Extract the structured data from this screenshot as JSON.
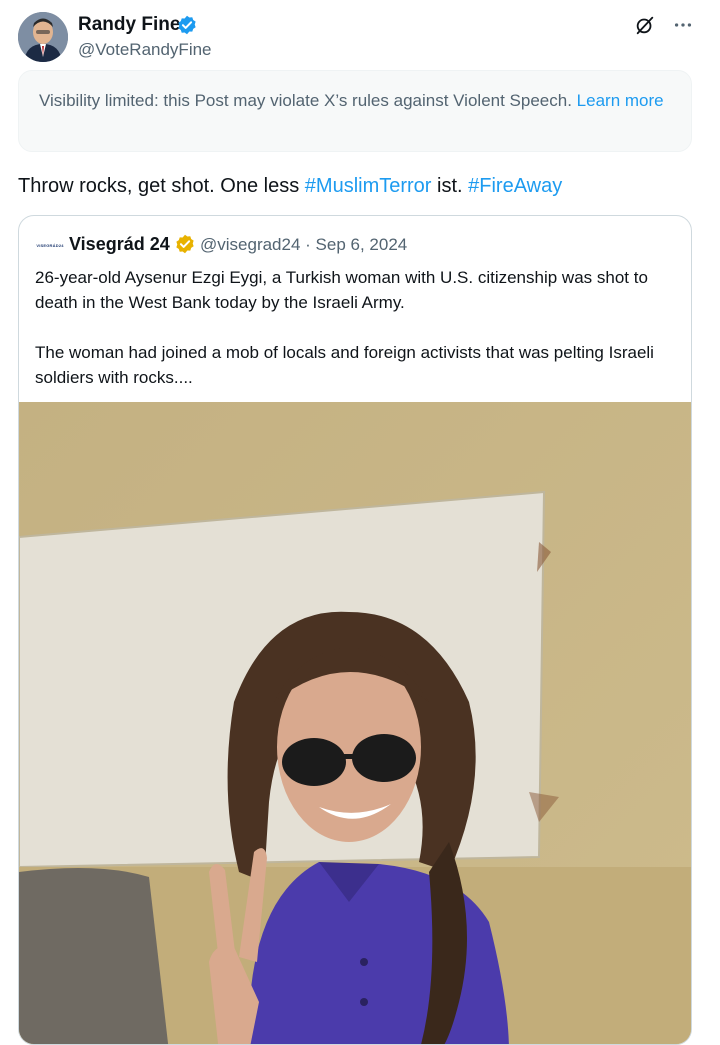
{
  "post": {
    "author": {
      "name": "Randy Fine",
      "handle": "@VoteRandyFine",
      "verified_color": "#1d9bf0"
    },
    "icons": [
      "grok-icon",
      "more-icon"
    ],
    "notice": {
      "text": "Visibility limited: this Post may violate X’s rules against Violent Speech.",
      "link": "Learn more"
    },
    "text": {
      "part1": "Throw rocks, get shot.  One less ",
      "hashtag1": "#MuslimTerror",
      "part2": " ist.  ",
      "hashtag2": "#FireAway"
    }
  },
  "quoted": {
    "avatar_text": "VISEGRÁD24",
    "name": "Visegrád 24",
    "verified_color": "#e8b200",
    "handle": "@visegrad24",
    "separator": " · ",
    "date": "Sep 6, 2024",
    "body": "26-year-old Aysenur Ezgi Eygi, a Turkish woman with U.S. citizenship was shot to death in the West Bank today by the Israeli Army.\n\nThe woman had joined a mob of locals and foreign activists that was pelting Israeli soldiers with rocks....",
    "media": {
      "description": "photo of a woman wearing sunglasses and a purple shirt making a peace sign"
    }
  },
  "colors": {
    "link": "#1d9bf0",
    "secondary_text": "#536471",
    "border": "#cfd9de"
  }
}
